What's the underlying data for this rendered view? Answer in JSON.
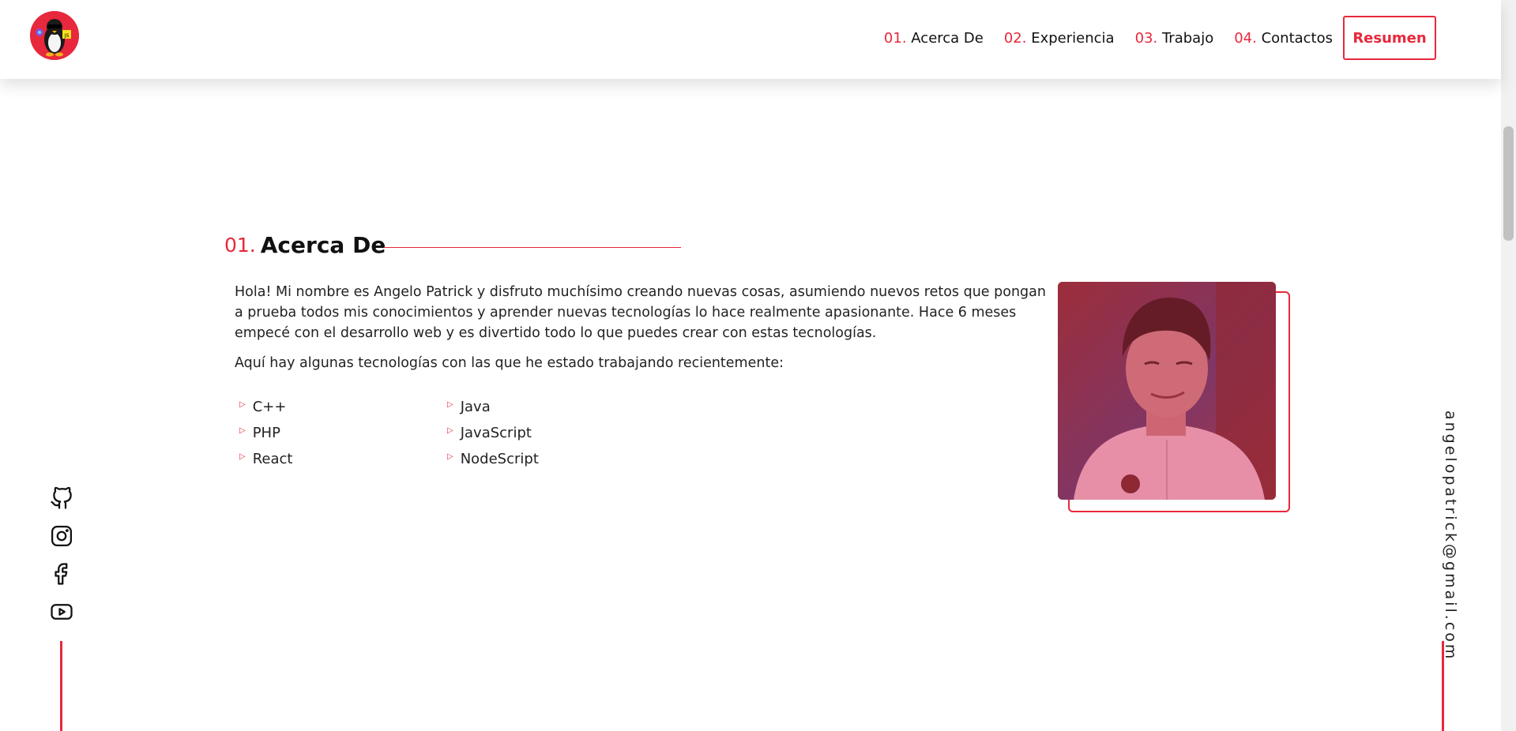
{
  "header": {
    "nav": [
      {
        "num": "01.",
        "label": "Acerca De"
      },
      {
        "num": "02.",
        "label": "Experiencia"
      },
      {
        "num": "03.",
        "label": "Trabajo"
      },
      {
        "num": "04.",
        "label": "Contactos"
      }
    ],
    "resume_label": "Resumen",
    "logo_badge": "JS"
  },
  "about": {
    "num": "01.",
    "title": "Acerca De",
    "paragraph1": "Hola! Mi nombre es Angelo Patrick y disfruto muchísimo creando nuevas cosas, asumiendo nuevos retos que pongan a prueba todos mis conocimientos y aprender nuevas tecnologías lo hace realmente apasionante. Hace 6 meses empecé con el desarrollo web y es divertido todo lo que puedes crear con estas tecnologías.",
    "paragraph2": "Aquí hay algunas tecnologías con las que he estado trabajando recientemente:",
    "technologies": [
      "C++",
      "Java",
      "PHP",
      "JavaScript",
      "React",
      "NodeScript"
    ]
  },
  "social": {
    "icons": [
      "github-icon",
      "instagram-icon",
      "facebook-icon",
      "youtube-icon"
    ]
  },
  "email": "angelopatrick@gmail.com",
  "colors": {
    "accent": "#e8283c",
    "text": "#111111",
    "background": "#ffffff"
  }
}
